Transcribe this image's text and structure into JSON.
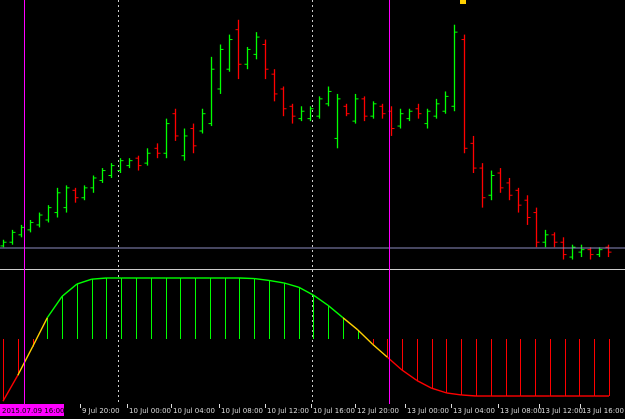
{
  "colors": {
    "background": "#000000",
    "bull": "#00ff00",
    "bear": "#ff0000",
    "grid": "#cccccc",
    "cursor_line": "#ff00ff",
    "price_line": "#8c8cbf",
    "separator": "#cccccc",
    "indicator_up": "#00ff00",
    "indicator_down": "#ff0000",
    "indicator_transition": "#ffd000",
    "axis_text": "#dddddd"
  },
  "time_axis": {
    "labels": [
      "9 Jul 20:00",
      "10 Jul 00:00",
      "10 Jul 04:00",
      "10 Jul 08:00",
      "10 Jul 12:00",
      "10 Jul 16:00",
      "12 Jul 20:00",
      "13 Jul 00:00",
      "13 Jul 04:00",
      "13 Jul 08:00",
      "13 Jul 12:00",
      "13 Jul 16:00"
    ],
    "cursor_stamp": "2015.07.09 16:00"
  },
  "chart_data": [
    {
      "type": "ohlc-bars",
      "bars": [
        {
          "dir": "up",
          "high": 3,
          "low": 0,
          "open": 0.5,
          "close": 2
        },
        {
          "dir": "up",
          "high": 7,
          "low": 1,
          "open": 2,
          "close": 6
        },
        {
          "dir": "up",
          "high": 9,
          "low": 4,
          "open": 5,
          "close": 8
        },
        {
          "dir": "up",
          "high": 11,
          "low": 6,
          "open": 7,
          "close": 10
        },
        {
          "dir": "up",
          "high": 14,
          "low": 8,
          "open": 9,
          "close": 13
        },
        {
          "dir": "up",
          "high": 17,
          "low": 10,
          "open": 11,
          "close": 16
        },
        {
          "dir": "up",
          "high": 24,
          "low": 12,
          "open": 14,
          "close": 22
        },
        {
          "dir": "up",
          "high": 25,
          "low": 14,
          "open": 16,
          "close": 24
        },
        {
          "dir": "down",
          "high": 24,
          "low": 18,
          "open": 23,
          "close": 20
        },
        {
          "dir": "up",
          "high": 25,
          "low": 19,
          "open": 20,
          "close": 24
        },
        {
          "dir": "up",
          "high": 29,
          "low": 22,
          "open": 24,
          "close": 28
        },
        {
          "dir": "up",
          "high": 32,
          "low": 26,
          "open": 27,
          "close": 31
        },
        {
          "dir": "up",
          "high": 34,
          "low": 28,
          "open": 29,
          "close": 33
        },
        {
          "dir": "up",
          "high": 36,
          "low": 30,
          "open": 31,
          "close": 35
        },
        {
          "dir": "up",
          "high": 36,
          "low": 32,
          "open": 33,
          "close": 35
        },
        {
          "dir": "down",
          "high": 37,
          "low": 31,
          "open": 36,
          "close": 33
        },
        {
          "dir": "up",
          "high": 40,
          "low": 33,
          "open": 34,
          "close": 38
        },
        {
          "dir": "down",
          "high": 42,
          "low": 36,
          "open": 40,
          "close": 38
        },
        {
          "dir": "up",
          "high": 52,
          "low": 36,
          "open": 38,
          "close": 50
        },
        {
          "dir": "down",
          "high": 56,
          "low": 43,
          "open": 54,
          "close": 45
        },
        {
          "dir": "up",
          "high": 48,
          "low": 35,
          "open": 37,
          "close": 45
        },
        {
          "dir": "down",
          "high": 50,
          "low": 38,
          "open": 48,
          "close": 41
        },
        {
          "dir": "up",
          "high": 56,
          "low": 46,
          "open": 47,
          "close": 54
        },
        {
          "dir": "up",
          "high": 77,
          "low": 49,
          "open": 50,
          "close": 72
        },
        {
          "dir": "up",
          "high": 82,
          "low": 62,
          "open": 64,
          "close": 80
        },
        {
          "dir": "up",
          "high": 86,
          "low": 71,
          "open": 72,
          "close": 84
        },
        {
          "dir": "down",
          "high": 92,
          "low": 68,
          "open": 88,
          "close": 74
        },
        {
          "dir": "up",
          "high": 81,
          "low": 72,
          "open": 74,
          "close": 80
        },
        {
          "dir": "up",
          "high": 87,
          "low": 76,
          "open": 78,
          "close": 85
        },
        {
          "dir": "down",
          "high": 84,
          "low": 68,
          "open": 82,
          "close": 72
        },
        {
          "dir": "down",
          "high": 72,
          "low": 59,
          "open": 70,
          "close": 62
        },
        {
          "dir": "down",
          "high": 65,
          "low": 53,
          "open": 64,
          "close": 56
        },
        {
          "dir": "down",
          "high": 58,
          "low": 50,
          "open": 57,
          "close": 53
        },
        {
          "dir": "up",
          "high": 57,
          "low": 51,
          "open": 52,
          "close": 55
        },
        {
          "dir": "up",
          "high": 57,
          "low": 51,
          "open": 52,
          "close": 56
        },
        {
          "dir": "up",
          "high": 61,
          "low": 52,
          "open": 53,
          "close": 60
        },
        {
          "dir": "up",
          "high": 65,
          "low": 57,
          "open": 58,
          "close": 63
        },
        {
          "dir": "up",
          "high": 62,
          "low": 40,
          "open": 44,
          "close": 60
        },
        {
          "dir": "down",
          "high": 58,
          "low": 53,
          "open": 57,
          "close": 54
        },
        {
          "dir": "up",
          "high": 62,
          "low": 50,
          "open": 51,
          "close": 60
        },
        {
          "dir": "down",
          "high": 61,
          "low": 51,
          "open": 60,
          "close": 53
        },
        {
          "dir": "up",
          "high": 59,
          "low": 52,
          "open": 53,
          "close": 58
        },
        {
          "dir": "down",
          "high": 58,
          "low": 52,
          "open": 57,
          "close": 54
        },
        {
          "dir": "down",
          "high": 57,
          "low": 45,
          "open": 55,
          "close": 48
        },
        {
          "dir": "up",
          "high": 56,
          "low": 48,
          "open": 49,
          "close": 54
        },
        {
          "dir": "up",
          "high": 56,
          "low": 51,
          "open": 52,
          "close": 55
        },
        {
          "dir": "down",
          "high": 58,
          "low": 52,
          "open": 56,
          "close": 54
        },
        {
          "dir": "up",
          "high": 56,
          "low": 48,
          "open": 50,
          "close": 55
        },
        {
          "dir": "up",
          "high": 60,
          "low": 52,
          "open": 53,
          "close": 58
        },
        {
          "dir": "up",
          "high": 63,
          "low": 54,
          "open": 55,
          "close": 61
        },
        {
          "dir": "up",
          "high": 90,
          "low": 55,
          "open": 57,
          "close": 87
        },
        {
          "dir": "down",
          "high": 86,
          "low": 38,
          "open": 84,
          "close": 40
        },
        {
          "dir": "down",
          "high": 45,
          "low": 30,
          "open": 42,
          "close": 32
        },
        {
          "dir": "down",
          "high": 34,
          "low": 16,
          "open": 32,
          "close": 20
        },
        {
          "dir": "up",
          "high": 31,
          "low": 19,
          "open": 21,
          "close": 29
        },
        {
          "dir": "down",
          "high": 32,
          "low": 22,
          "open": 30,
          "close": 24
        },
        {
          "dir": "down",
          "high": 28,
          "low": 19,
          "open": 26,
          "close": 21
        },
        {
          "dir": "down",
          "high": 24,
          "low": 14,
          "open": 23,
          "close": 17
        },
        {
          "dir": "down",
          "high": 21,
          "low": 9,
          "open": 19,
          "close": 12
        },
        {
          "dir": "down",
          "high": 16,
          "low": 0,
          "open": 14,
          "close": 2
        },
        {
          "dir": "up",
          "high": 7,
          "low": 0,
          "open": 2,
          "close": 5
        },
        {
          "dir": "down",
          "high": 6,
          "low": 0,
          "open": 5,
          "close": 2
        },
        {
          "dir": "down",
          "high": 4,
          "low": -5,
          "open": 2,
          "close": -3
        },
        {
          "dir": "up",
          "high": 1,
          "low": -5,
          "open": -4,
          "close": 0
        },
        {
          "dir": "up",
          "high": 1,
          "low": -4,
          "open": -2,
          "close": -1
        },
        {
          "dir": "down",
          "high": 0,
          "low": -5,
          "open": -1,
          "close": -3
        },
        {
          "dir": "up",
          "high": 0,
          "low": -4,
          "open": -3,
          "close": -1
        },
        {
          "dir": "down",
          "high": 1,
          "low": -4,
          "open": 0,
          "close": -2
        }
      ]
    },
    {
      "type": "histogram-line",
      "values": [
        -1.2,
        -0.7,
        -0.15,
        0.35,
        0.7,
        0.9,
        0.98,
        1.0,
        1.0,
        1.0,
        1.0,
        1.0,
        1.0,
        1.0,
        1.0,
        1.0,
        1.0,
        0.99,
        0.96,
        0.92,
        0.85,
        0.72,
        0.55,
        0.35,
        0.15,
        -0.1,
        -0.35,
        -0.6,
        -0.8,
        -0.95,
        -1.04,
        -1.08,
        -1.1,
        -1.1,
        -1.1,
        -1.1,
        -1.1,
        -1.1,
        -1.1,
        -1.1,
        -1.1,
        -1.1
      ]
    }
  ]
}
